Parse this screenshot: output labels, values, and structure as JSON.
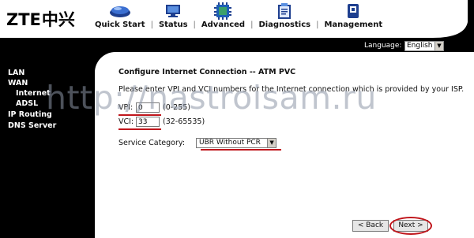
{
  "brand": {
    "name": "ZTE",
    "name_cn": "中兴"
  },
  "nav": [
    {
      "label": "Quick Start",
      "icon": "quick-start-icon"
    },
    {
      "label": "Status",
      "icon": "monitor-icon"
    },
    {
      "label": "Advanced",
      "icon": "chip-icon"
    },
    {
      "label": "Diagnostics",
      "icon": "clipboard-icon"
    },
    {
      "label": "Management",
      "icon": "device-icon"
    }
  ],
  "nav_separator": "|",
  "language": {
    "label": "Language:",
    "selected": "English"
  },
  "sidebar": {
    "items": [
      "LAN",
      "WAN",
      "Internet",
      "ADSL",
      "IP Routing",
      "DNS Server"
    ]
  },
  "main": {
    "title": "Configure Internet Connection -- ATM PVC",
    "description": "Please enter VPI and VCI numbers for the Internet connection which is provided by your ISP.",
    "vpi": {
      "label": "VPI:",
      "value": "0",
      "range": "(0-255)"
    },
    "vci": {
      "label": "VCI:",
      "value": "33",
      "range": "(32-65535)"
    },
    "service": {
      "label": "Service Category:",
      "selected": "UBR Without PCR"
    },
    "back_label": "< Back",
    "next_label": "Next >"
  },
  "watermark": "http://nastroisam.ru",
  "colors": {
    "highlight": "#c0161c",
    "sidebar_bg": "#000000",
    "content_bg": "#ffffff"
  }
}
